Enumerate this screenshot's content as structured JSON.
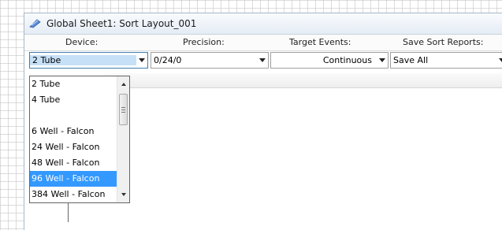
{
  "window": {
    "title": "Global Sheet1: Sort Layout_001"
  },
  "icons": {
    "title": "sort-layout-icon",
    "dropdown_arrow": "chevron-down-icon"
  },
  "headers": {
    "device": "Device:",
    "precision": "Precision:",
    "target_events": "Target Events:",
    "save_sort_reports": "Save Sort Reports:"
  },
  "controls": {
    "device": "2 Tube",
    "precision": "0/24/0",
    "target_events": "Continuous",
    "save_sort_reports": "Save All"
  },
  "device_dropdown": {
    "items": [
      "2 Tube",
      "4 Tube",
      "",
      "6 Well - Falcon",
      "24 Well - Falcon",
      "48 Well - Falcon",
      "96 Well - Falcon",
      "384 Well - Falcon"
    ],
    "selected": "96 Well - Falcon"
  },
  "colors": {
    "selection": "#3399ff",
    "focus_highlight": "#c6e0f7"
  }
}
